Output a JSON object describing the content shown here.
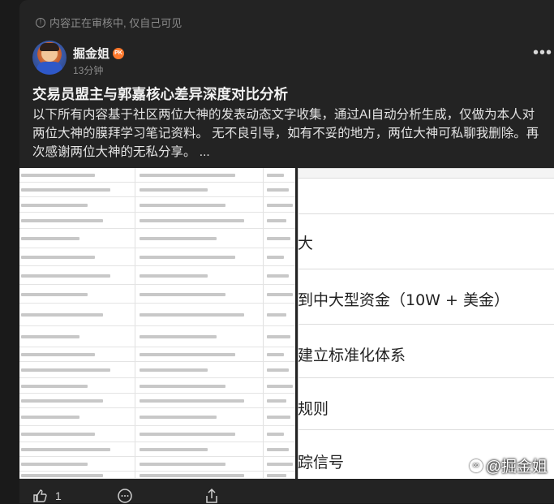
{
  "post": {
    "review_notice": "内容正在审核中, 仅自己可见",
    "author": "掘金姐",
    "badge": "PK",
    "time": "13分钟",
    "title": "交易员盟主与郭嘉核心差异深度对比分析",
    "body": "以下所有内容基于社区两位大神的发表动态文字收集，通过AI自动分析生成，仅做为本人对两位大神的膜拜学习笔记资料。 无不良引导，如有不妥的地方，两位大神可私聊我删除。再次感谢两位大神的无私分享。 ...",
    "more_label": "•••"
  },
  "image_right": {
    "rows": [
      "大",
      "到中大型资金（10W + 美金）",
      "建立标准化体系",
      "规则",
      "踪信号"
    ]
  },
  "watermark": {
    "text": "@掘金姐"
  },
  "actions": {
    "like_count": "1"
  }
}
